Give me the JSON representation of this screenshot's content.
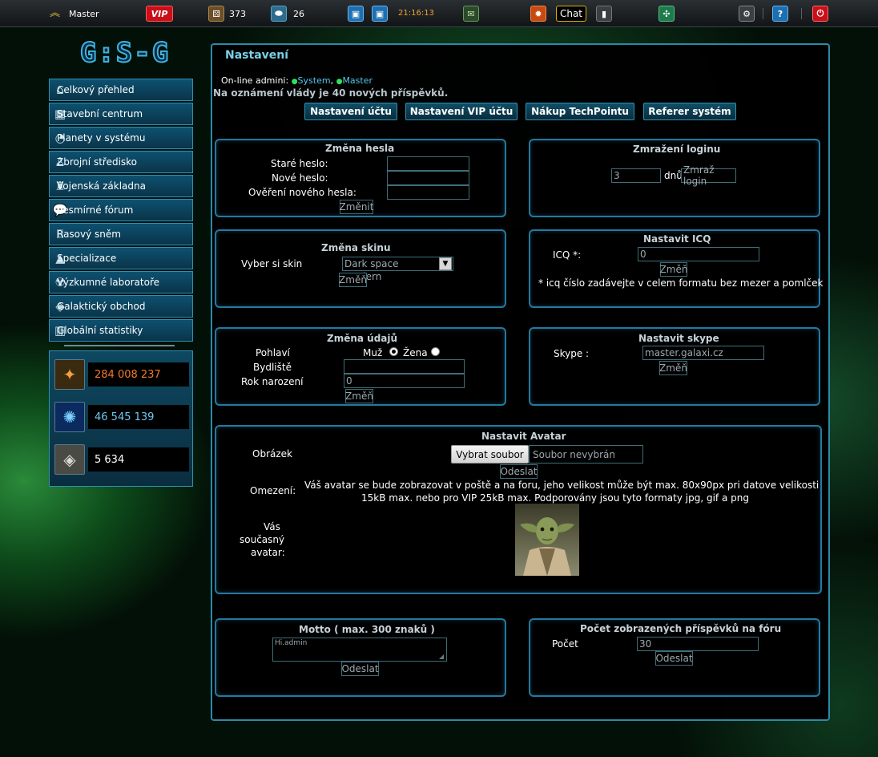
{
  "topbar": {
    "username": "Master",
    "vip_label": "VIP",
    "stat1": "373",
    "stat2": "26",
    "time": "21:16:13",
    "chat_label": "Chat",
    "help_label": "?"
  },
  "logo_text": "G:S-G",
  "menu": [
    {
      "label": "Celkový přehled",
      "icon": "home-icon"
    },
    {
      "label": "Stavební centrum",
      "icon": "building-icon"
    },
    {
      "label": "Planety v systému",
      "icon": "planet-icon"
    },
    {
      "label": "Zbrojní středisko",
      "icon": "soldier-icon"
    },
    {
      "label": "Vojenská základna",
      "icon": "base-icon"
    },
    {
      "label": "Vesmírné fórum",
      "icon": "chat-bubble-icon"
    },
    {
      "label": "Rasový sněm",
      "icon": "senate-icon"
    },
    {
      "label": "Specializace",
      "icon": "specialization-icon"
    },
    {
      "label": "Výzkumné laboratoře",
      "icon": "radiation-icon"
    },
    {
      "label": "Galaktický obchod",
      "icon": "trade-tag-icon"
    },
    {
      "label": "Globální statistiky",
      "icon": "bar-chart-icon"
    }
  ],
  "resources": [
    {
      "value": "284 008 237",
      "color": "#f07a2a"
    },
    {
      "value": "46 545 139",
      "color": "#6cc8f5"
    },
    {
      "value": "5 634",
      "color": "#ffffff"
    }
  ],
  "main": {
    "title": "Nastavení",
    "online_label": "On-line admini:",
    "admins": [
      "System",
      "Master"
    ],
    "notice": "Na oznámení vlády je 40 nových příspěvků.",
    "tabs": [
      "Nastavení účtu",
      "Nastavení VIP účtu",
      "Nákup TechPointu",
      "Referer systém"
    ]
  },
  "password": {
    "title": "Změna hesla",
    "old_label": "Staré heslo:",
    "new_label": "Nové heslo:",
    "confirm_label": "Ověření nového hesla:",
    "button": "Změnit"
  },
  "freeze": {
    "title": "Zmražení loginu",
    "days_value": "3",
    "days_unit": "dnů",
    "button": "Zmraž login"
  },
  "skin": {
    "title": "Změna skinu",
    "label": "Vyber si skin",
    "selected": "Dark space modern",
    "button": "Změň"
  },
  "icq": {
    "title": "Nastavit ICQ",
    "label": "ICQ *:",
    "value": "0",
    "button": "Změň",
    "note": "* icq číslo zadávejte v celem formatu bez mezer a pomlček"
  },
  "details": {
    "title": "Změna údajů",
    "gender_label": "Pohlaví",
    "male": "Muž",
    "female": "Žena",
    "residence_label": "Bydliště",
    "residence_value": "",
    "birth_label": "Rok narození",
    "birth_value": "0",
    "button": "Změň"
  },
  "skype": {
    "title": "Nastavit skype",
    "label": "Skype :",
    "value": "master.galaxi.cz",
    "button": "Změň"
  },
  "avatar": {
    "title": "Nastavit Avatar",
    "image_label": "Obrázek",
    "choose_button": "Vybrat soubor",
    "no_file": "Soubor nevybrán",
    "send_button": "Odeslat",
    "limit_label": "Omezení:",
    "limit_text_1": "Váš avatar se bude zobrazovat v poště a na foru, jeho velikost může být max. 80x90px pri datove velikosti",
    "limit_text_2": "15kB max. nebo pro VIP 25kB max. Podporovány jsou tyto formaty jpg, gif a png",
    "current_label_1": "Vás",
    "current_label_2": "současný",
    "current_label_3": "avatar:"
  },
  "motto": {
    "title": "Motto ( max. 300 znaků )",
    "value": "Hi.admin",
    "button": "Odeslat"
  },
  "posts": {
    "title": "Počet zobrazených příspěvků na fóru",
    "label": "Počet",
    "value": "30",
    "button": "Odeslat"
  }
}
